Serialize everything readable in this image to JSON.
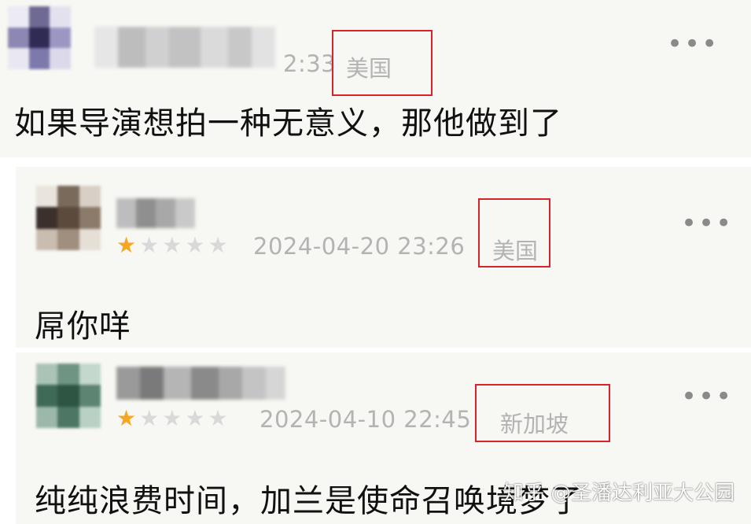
{
  "top_comment": {
    "time": "2:33",
    "region": "美国",
    "text": "如果导演想拍一种无意义，那他做到了",
    "more": "•••"
  },
  "reply1": {
    "rating": 1,
    "max_rating": 5,
    "timestamp": "2024-04-20 23:26",
    "region": "美国",
    "text": "屌你咩",
    "more": "•••"
  },
  "reply2": {
    "rating": 1,
    "max_rating": 5,
    "timestamp": "2024-04-10 22:45",
    "region": "新加坡",
    "text": "纯纯浪费时间，加兰是使命召唤境梦了",
    "more": "•••"
  },
  "watermark": "知乎 @圣潘达利亚大公园",
  "colors": {
    "highlight_box": "#d8232a",
    "star_filled": "#f5a623",
    "star_empty": "#d9d9d9",
    "meta_text": "#b3b3b3"
  }
}
